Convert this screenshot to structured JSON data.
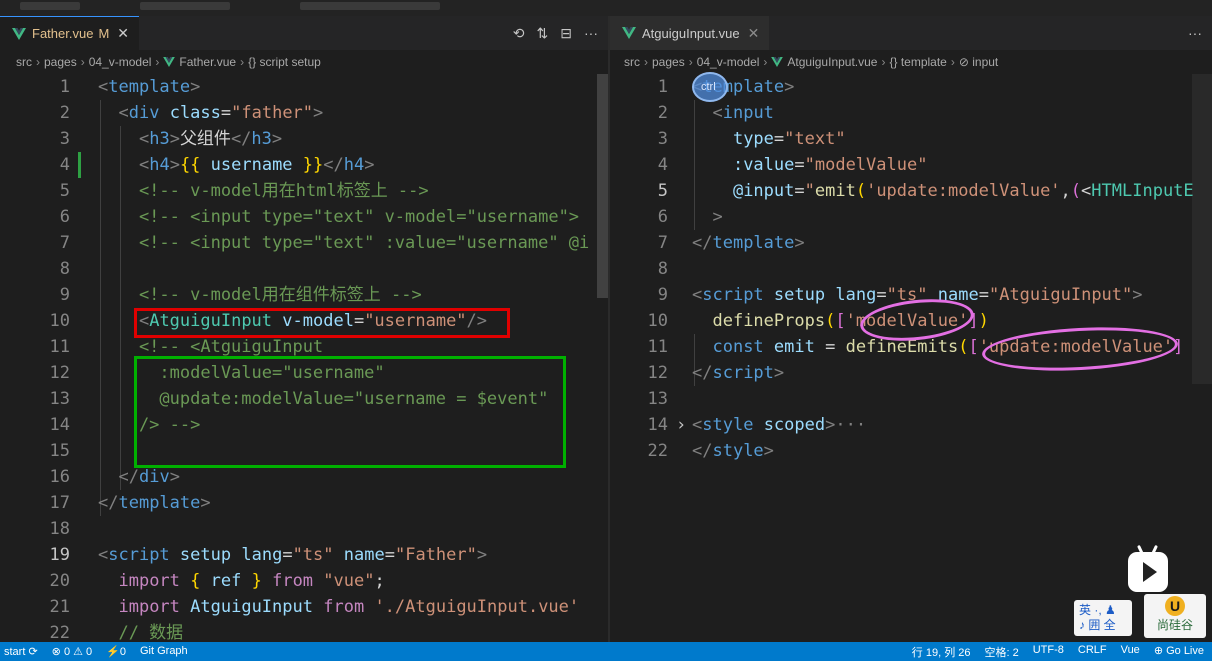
{
  "left_editor": {
    "tab": {
      "name": "Father.vue",
      "modified": "M",
      "close": "✕"
    },
    "actions": [
      "⟲",
      "⇅",
      "⊟",
      "···"
    ],
    "breadcrumb": [
      "src",
      "pages",
      "04_v-model",
      "Father.vue",
      "{} script setup"
    ],
    "line_numbers": [
      "1",
      "2",
      "3",
      "4",
      "5",
      "6",
      "7",
      "8",
      "9",
      "10",
      "11",
      "12",
      "13",
      "14",
      "15",
      "16",
      "17",
      "18",
      "19",
      "20",
      "21",
      "22"
    ],
    "code": [
      [
        [
          "<",
          "t-brk"
        ],
        [
          "template",
          "t-tag"
        ],
        [
          ">",
          "t-brk"
        ]
      ],
      [
        [
          "  ",
          ""
        ],
        [
          "<",
          "t-brk"
        ],
        [
          "div",
          "t-tag"
        ],
        [
          " ",
          ""
        ],
        [
          "class",
          "t-attr"
        ],
        [
          "=",
          "t-text"
        ],
        [
          "\"father\"",
          "t-str"
        ],
        [
          ">",
          "t-brk"
        ]
      ],
      [
        [
          "    ",
          ""
        ],
        [
          "<",
          "t-brk"
        ],
        [
          "h3",
          "t-tag"
        ],
        [
          ">",
          "t-brk"
        ],
        [
          "父组件",
          "t-text"
        ],
        [
          "</",
          "t-brk"
        ],
        [
          "h3",
          "t-tag"
        ],
        [
          ">",
          "t-brk"
        ]
      ],
      [
        [
          "    ",
          ""
        ],
        [
          "<",
          "t-brk"
        ],
        [
          "h4",
          "t-tag"
        ],
        [
          ">",
          "t-brk"
        ],
        [
          "{{",
          "t-br"
        ],
        [
          " username ",
          "t-var"
        ],
        [
          "}}",
          "t-br"
        ],
        [
          "</",
          "t-brk"
        ],
        [
          "h4",
          "t-tag"
        ],
        [
          ">",
          "t-brk"
        ]
      ],
      [
        [
          "    <!-- v-model用在html标签上 -->",
          "t-com"
        ]
      ],
      [
        [
          "    <!-- <input type=\"text\" v-model=\"username\">",
          "t-com"
        ]
      ],
      [
        [
          "    <!-- <input type=\"text\" :value=\"username\" @i",
          "t-com"
        ]
      ],
      [
        [
          "",
          ""
        ]
      ],
      [
        [
          "    <!-- v-model用在组件标签上 -->",
          "t-com"
        ]
      ],
      [
        [
          "    ",
          ""
        ],
        [
          "<",
          "t-brk"
        ],
        [
          "AtguiguInput",
          "t-cls"
        ],
        [
          " ",
          ""
        ],
        [
          "v-model",
          "t-attr"
        ],
        [
          "=",
          "t-text"
        ],
        [
          "\"username\"",
          "t-str"
        ],
        [
          "/>",
          "t-brk"
        ]
      ],
      [
        [
          "    <!-- <AtguiguInput",
          "t-com"
        ]
      ],
      [
        [
          "      :modelValue=\"username\"",
          "t-com"
        ]
      ],
      [
        [
          "      @update:modelValue=\"username = $event\"",
          "t-com"
        ]
      ],
      [
        [
          "    /> -->",
          "t-com"
        ]
      ],
      [
        [
          "",
          ""
        ]
      ],
      [
        [
          "  ",
          ""
        ],
        [
          "</",
          "t-brk"
        ],
        [
          "div",
          "t-tag"
        ],
        [
          ">",
          "t-brk"
        ]
      ],
      [
        [
          "</",
          "t-brk"
        ],
        [
          "template",
          "t-tag"
        ],
        [
          ">",
          "t-brk"
        ]
      ],
      [
        [
          "",
          ""
        ]
      ],
      [
        [
          "<",
          "t-brk"
        ],
        [
          "script",
          "t-tag"
        ],
        [
          " ",
          ""
        ],
        [
          "setup",
          "t-attr"
        ],
        [
          " ",
          ""
        ],
        [
          "lang",
          "t-attr"
        ],
        [
          "=",
          "t-text"
        ],
        [
          "\"ts\"",
          "t-str"
        ],
        [
          " ",
          ""
        ],
        [
          "name",
          "t-attr"
        ],
        [
          "=",
          "t-text"
        ],
        [
          "\"Father\"",
          "t-str"
        ],
        [
          ">",
          "t-brk"
        ]
      ],
      [
        [
          "  ",
          ""
        ],
        [
          "import",
          "t-kw"
        ],
        [
          " ",
          ""
        ],
        [
          "{",
          "t-br"
        ],
        [
          " ref ",
          "t-var"
        ],
        [
          "}",
          "t-br"
        ],
        [
          " ",
          ""
        ],
        [
          "from",
          "t-kw"
        ],
        [
          " ",
          ""
        ],
        [
          "\"vue\"",
          "t-str"
        ],
        [
          ";",
          "t-text"
        ]
      ],
      [
        [
          "  ",
          ""
        ],
        [
          "import",
          "t-kw"
        ],
        [
          " ",
          ""
        ],
        [
          "AtguiguInput",
          "t-var"
        ],
        [
          " ",
          ""
        ],
        [
          "from",
          "t-kw"
        ],
        [
          " ",
          ""
        ],
        [
          "'./AtguiguInput.vue'",
          "t-str"
        ]
      ],
      [
        [
          "  // 数据",
          "t-com"
        ]
      ]
    ]
  },
  "right_editor": {
    "tab": {
      "name": "AtguiguInput.vue",
      "close": "✕"
    },
    "actions": [
      "···"
    ],
    "breadcrumb": [
      "src",
      "pages",
      "04_v-model",
      "AtguiguInput.vue",
      "{} template",
      "⊘ input"
    ],
    "line_numbers": [
      "1",
      "2",
      "3",
      "4",
      "5",
      "6",
      "7",
      "8",
      "9",
      "10",
      "11",
      "12",
      "13",
      "14",
      "22"
    ],
    "code": [
      [
        [
          "<",
          "t-brk"
        ],
        [
          "template",
          "t-tag"
        ],
        [
          ">",
          "t-brk"
        ]
      ],
      [
        [
          "  ",
          ""
        ],
        [
          "<",
          "t-brk"
        ],
        [
          "input",
          "t-tag"
        ]
      ],
      [
        [
          "    ",
          ""
        ],
        [
          "type",
          "t-attr"
        ],
        [
          "=",
          "t-text"
        ],
        [
          "\"text\"",
          "t-str"
        ]
      ],
      [
        [
          "    ",
          ""
        ],
        [
          ":value",
          "t-attr"
        ],
        [
          "=",
          "t-text"
        ],
        [
          "\"modelValue\"",
          "t-str"
        ]
      ],
      [
        [
          "    ",
          ""
        ],
        [
          "@input",
          "t-attr"
        ],
        [
          "=",
          "t-text"
        ],
        [
          "\"",
          "t-str"
        ],
        [
          "emit",
          "t-fn"
        ],
        [
          "(",
          "t-br"
        ],
        [
          "'update:modelValue'",
          "t-str"
        ],
        [
          ",",
          "t-text"
        ],
        [
          "(",
          "t-br2"
        ],
        [
          "<",
          "t-text"
        ],
        [
          "HTMLInputE",
          "t-cls"
        ]
      ],
      [
        [
          "  ",
          ""
        ],
        [
          ">",
          "t-brk"
        ]
      ],
      [
        [
          "</",
          "t-brk"
        ],
        [
          "template",
          "t-tag"
        ],
        [
          ">",
          "t-brk"
        ]
      ],
      [
        [
          "",
          ""
        ]
      ],
      [
        [
          "<",
          "t-brk"
        ],
        [
          "script",
          "t-tag"
        ],
        [
          " ",
          ""
        ],
        [
          "setup",
          "t-attr"
        ],
        [
          " ",
          ""
        ],
        [
          "lang",
          "t-attr"
        ],
        [
          "=",
          "t-text"
        ],
        [
          "\"ts\"",
          "t-str"
        ],
        [
          " ",
          ""
        ],
        [
          "name",
          "t-attr"
        ],
        [
          "=",
          "t-text"
        ],
        [
          "\"AtguiguInput\"",
          "t-str"
        ],
        [
          ">",
          "t-brk"
        ]
      ],
      [
        [
          "  ",
          ""
        ],
        [
          "defineProps",
          "t-fn"
        ],
        [
          "(",
          "t-br"
        ],
        [
          "[",
          "t-br2"
        ],
        [
          "'modelValue'",
          "t-str"
        ],
        [
          "]",
          "t-br2"
        ],
        [
          ")",
          "t-br"
        ]
      ],
      [
        [
          "  ",
          ""
        ],
        [
          "const",
          "t-const"
        ],
        [
          " ",
          ""
        ],
        [
          "emit",
          "t-var"
        ],
        [
          " = ",
          "t-text"
        ],
        [
          "defineEmits",
          "t-fn"
        ],
        [
          "(",
          "t-br"
        ],
        [
          "[",
          "t-br2"
        ],
        [
          "'update:modelValue'",
          "t-str"
        ],
        [
          "]",
          "t-br2"
        ]
      ],
      [
        [
          "</",
          "t-brk"
        ],
        [
          "script",
          "t-tag"
        ],
        [
          ">",
          "t-brk"
        ]
      ],
      [
        [
          "",
          ""
        ]
      ],
      [
        [
          "<",
          "t-brk"
        ],
        [
          "style",
          "t-tag"
        ],
        [
          " ",
          ""
        ],
        [
          "scoped",
          "t-attr"
        ],
        [
          ">",
          "t-brk"
        ],
        [
          "···",
          "t-brk"
        ]
      ],
      [
        [
          "</",
          "t-brk"
        ],
        [
          "style",
          "t-tag"
        ],
        [
          ">",
          "t-brk"
        ]
      ]
    ]
  },
  "overlays": {
    "cursor_label": "ctrl",
    "ime_line1": "英 ·, ♟",
    "ime_line2": "♪ 囲 全",
    "brand_icon": "U",
    "brand_label": "尚硅谷"
  },
  "statusbar": {
    "left": [
      "start ⟳",
      "⊗ 0 ⚠ 0",
      "⚡0",
      "Git Graph"
    ],
    "right": [
      "行 19, 列 26",
      "空格: 2",
      "UTF-8",
      "CRLF",
      "Vue",
      "⊕ Go Live"
    ]
  }
}
